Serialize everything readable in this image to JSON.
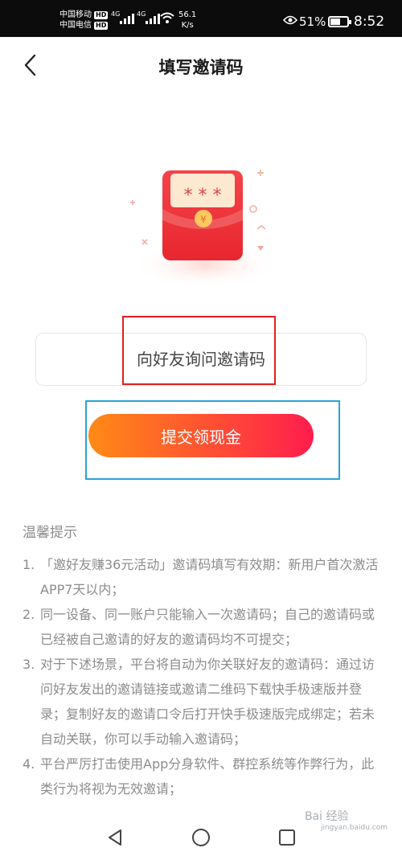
{
  "status_bar": {
    "carrier_1": "中国移动",
    "carrier_2": "中国电信",
    "hd_tag": "HD",
    "network_tag": "4G",
    "speed_value": "56.1",
    "speed_unit": "K/s",
    "battery": "51%",
    "time": "8:52"
  },
  "header": {
    "title": "填写邀请码",
    "back_icon": "chevron-left-icon"
  },
  "invite": {
    "placeholder": "向好友询问邀请码",
    "submit_label": "提交领现金",
    "card_stars": "* * *",
    "coin_symbol": "¥"
  },
  "tips": {
    "title": "温馨提示",
    "items": [
      {
        "num": "1.",
        "text": "「邀好友赚36元活动」邀请码填写有效期：新用户首次激活APP7天以内；"
      },
      {
        "num": "2.",
        "text": "同一设备、同一账户只能输入一次邀请码；自己的邀请码或已经被自己邀请的好友的邀请码均不可提交；"
      },
      {
        "num": "3.",
        "text": "对于下述场景，平台将自动为你关联好友的邀请码：通过访问好友发出的邀请链接或邀请二维码下载快手极速版并登录；复制好友的邀请口令后打开快手极速版完成绑定；若未自动关联，你可以手动输入邀请码；"
      },
      {
        "num": "4.",
        "text": "平台严厉打击使用App分身软件、群控系统等作弊行为，此类行为将视为无效邀请；"
      }
    ]
  },
  "watermark": {
    "text": "Bai 经验",
    "sub": "jingyan.baidu.com"
  },
  "colors": {
    "button_start": "#ff8a16",
    "button_end": "#ff1d4e",
    "envelope_red": "#f0383a",
    "highlight_red": "#e02020",
    "highlight_blue": "#2aa2d6"
  }
}
